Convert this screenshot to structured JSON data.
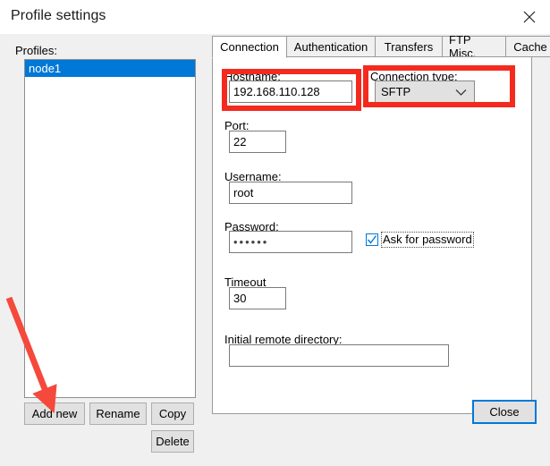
{
  "window": {
    "title": "Profile settings",
    "close_icon": "close-icon"
  },
  "left_pane": {
    "profiles_label": "Profiles:",
    "profiles": [
      {
        "name": "node1",
        "selected": true
      }
    ],
    "buttons": {
      "add_new": "Add new",
      "rename": "Rename",
      "copy": "Copy",
      "delete": "Delete"
    }
  },
  "right_pane": {
    "tabs": [
      {
        "label": "Connection",
        "active": true
      },
      {
        "label": "Authentication",
        "active": false
      },
      {
        "label": "Transfers",
        "active": false
      },
      {
        "label": "FTP Misc.",
        "active": false
      },
      {
        "label": "Cache",
        "active": false
      }
    ],
    "connection": {
      "hostname_label": "Hostname:",
      "hostname_value": "192.168.110.128",
      "connection_type_label": "Connection type:",
      "connection_type_value": "SFTP",
      "connection_type_options": [
        "SFTP"
      ],
      "port_label": "Port:",
      "port_value": "22",
      "username_label": "Username:",
      "username_value": "root",
      "password_label": "Password:",
      "password_value": "••••••",
      "ask_for_password_label": "Ask for password",
      "ask_for_password_checked": true,
      "timeout_label": "Timeout",
      "timeout_value": "30",
      "initial_remote_directory_label": "Initial remote directory:",
      "initial_remote_directory_value": ""
    }
  },
  "footer": {
    "close_button": "Close"
  },
  "annotations": {
    "highlight_color": "#f52a1e",
    "arrow_color": "#f5493c",
    "boxes": [
      "hostname-field",
      "connection-type-field"
    ],
    "arrow_target": "add-new-button"
  },
  "colors": {
    "selection_blue": "#0078d7",
    "dialog_background": "#f0f0f0",
    "panel_background": "#ffffff"
  }
}
